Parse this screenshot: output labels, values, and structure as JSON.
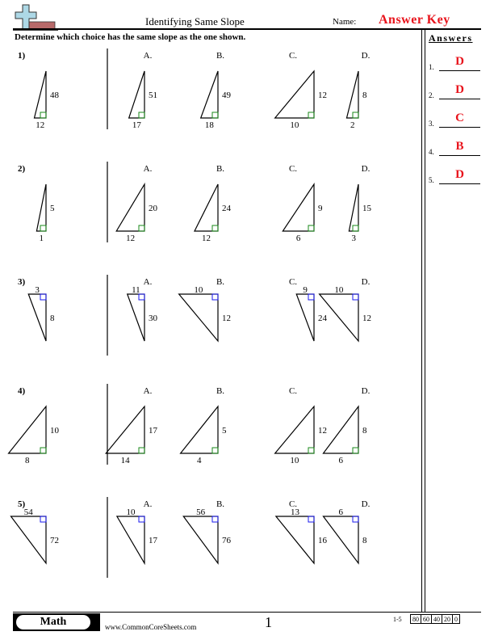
{
  "header": {
    "title": "Identifying Same Slope",
    "name_label": "Name:",
    "answer_key": "Answer Key",
    "instructions": "Determine which choice has the same slope as the one shown."
  },
  "answers_panel": {
    "title": "Answers",
    "items": [
      {
        "num": "1.",
        "answer": "D"
      },
      {
        "num": "2.",
        "answer": "D"
      },
      {
        "num": "3.",
        "answer": "C"
      },
      {
        "num": "4.",
        "answer": "B"
      },
      {
        "num": "5.",
        "answer": "D"
      }
    ]
  },
  "colors": {
    "answer_red": "#e8141c",
    "right_angle_upright": "#1a8a1a",
    "right_angle_inverted": "#1a1aee"
  },
  "problems": [
    {
      "label": "1)",
      "orientation": "upright",
      "given": {
        "run": 12,
        "rise": 48
      },
      "choices": [
        {
          "letter": "A.",
          "run": 17,
          "rise": 51
        },
        {
          "letter": "B.",
          "run": 18,
          "rise": 49
        },
        {
          "letter": "C.",
          "run": 10,
          "rise": 12
        },
        {
          "letter": "D.",
          "run": 2,
          "rise": 8
        }
      ]
    },
    {
      "label": "2)",
      "orientation": "upright",
      "given": {
        "run": 1,
        "rise": 5
      },
      "choices": [
        {
          "letter": "A.",
          "run": 12,
          "rise": 20
        },
        {
          "letter": "B.",
          "run": 12,
          "rise": 24
        },
        {
          "letter": "C.",
          "run": 6,
          "rise": 9
        },
        {
          "letter": "D.",
          "run": 3,
          "rise": 15
        }
      ]
    },
    {
      "label": "3)",
      "orientation": "inverted",
      "given": {
        "run": 3,
        "rise": 8
      },
      "choices": [
        {
          "letter": "A.",
          "run": 11,
          "rise": 30
        },
        {
          "letter": "B.",
          "run": 10,
          "rise": 12
        },
        {
          "letter": "C.",
          "run": 9,
          "rise": 24
        },
        {
          "letter": "D.",
          "run": 10,
          "rise": 12
        }
      ]
    },
    {
      "label": "4)",
      "orientation": "upright",
      "given": {
        "run": 8,
        "rise": 10
      },
      "choices": [
        {
          "letter": "A.",
          "run": 14,
          "rise": 17
        },
        {
          "letter": "B.",
          "run": 4,
          "rise": 5
        },
        {
          "letter": "C.",
          "run": 10,
          "rise": 12
        },
        {
          "letter": "D.",
          "run": 6,
          "rise": 8
        }
      ]
    },
    {
      "label": "5)",
      "orientation": "inverted",
      "given": {
        "run": 54,
        "rise": 72
      },
      "choices": [
        {
          "letter": "A.",
          "run": 10,
          "rise": 17
        },
        {
          "letter": "B.",
          "run": 56,
          "rise": 76
        },
        {
          "letter": "C.",
          "run": 13,
          "rise": 16
        },
        {
          "letter": "D.",
          "run": 6,
          "rise": 8
        }
      ]
    }
  ],
  "footer": {
    "subject": "Math",
    "website": "www.CommonCoreSheets.com",
    "page_number": "1",
    "score_range": "1-5",
    "score_values": [
      "80",
      "60",
      "40",
      "20",
      "0"
    ]
  }
}
